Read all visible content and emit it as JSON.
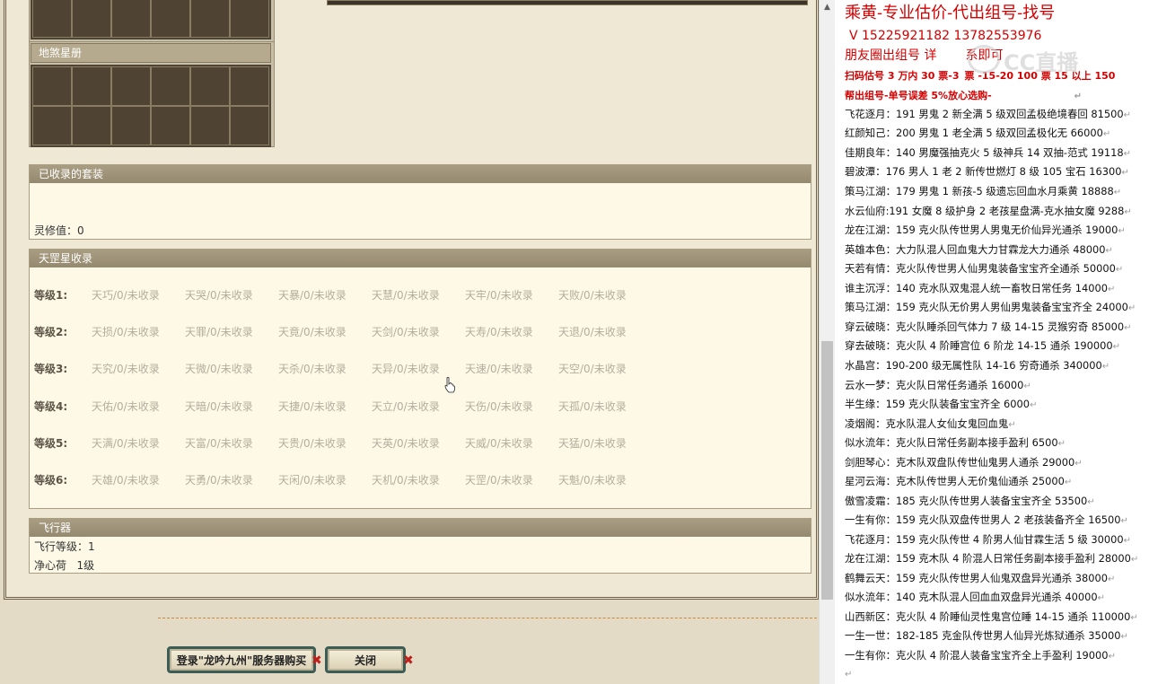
{
  "game": {
    "earth_star_header": "地煞星册",
    "suits_header": "已收录的套装",
    "spirit_value_label": "灵修值：",
    "spirit_value": "0",
    "tiangang_header": "天罡星收录",
    "levels": [
      {
        "label": "等级1:",
        "stars": [
          "天巧/0/未收录",
          "天哭/0/未收录",
          "天暴/0/未收录",
          "天慧/0/未收录",
          "天牢/0/未收录",
          "天败/0/未收录"
        ]
      },
      {
        "label": "等级2:",
        "stars": [
          "天损/0/未收录",
          "天罪/0/未收录",
          "天竟/0/未收录",
          "天剑/0/未收录",
          "天寿/0/未收录",
          "天退/0/未收录"
        ]
      },
      {
        "label": "等级3:",
        "stars": [
          "天究/0/未收录",
          "天微/0/未收录",
          "天杀/0/未收录",
          "天异/0/未收录",
          "天速/0/未收录",
          "天空/0/未收录"
        ]
      },
      {
        "label": "等级4:",
        "stars": [
          "天佑/0/未收录",
          "天暗/0/未收录",
          "天捷/0/未收录",
          "天立/0/未收录",
          "天伤/0/未收录",
          "天孤/0/未收录"
        ]
      },
      {
        "label": "等级5:",
        "stars": [
          "天满/0/未收录",
          "天富/0/未收录",
          "天贵/0/未收录",
          "天英/0/未收录",
          "天威/0/未收录",
          "天猛/0/未收录"
        ]
      },
      {
        "label": "等级6:",
        "stars": [
          "天雄/0/未收录",
          "天勇/0/未收录",
          "天闲/0/未收录",
          "天机/0/未收录",
          "天罡/0/未收录",
          "天魁/0/未收录"
        ]
      }
    ],
    "aircraft_header": "飞行器",
    "aircraft_level_label": "飞行等级：",
    "aircraft_level": "1",
    "jingxin_label": "净心荷",
    "jingxin_value": "1级",
    "buy_button": "登录\"龙吟九州\"服务器购买",
    "close_button": "关闭",
    "close_x": "✖"
  },
  "doc": {
    "title": "乘黄-专业估价-代出组号-找号",
    "contact": "V 15225921182   13782553976",
    "moments": "朋友圈出组号    详",
    "moments_tail": "系即可",
    "watermark": "CC直播",
    "line_red1": "扫码估号 3 万内 30 票-3",
    "line_red1_tail": "票 -15-20 100 票 15 以上 150",
    "line_red2": "帮出组号-单号误差 5%放心选购-",
    "entries": [
      "飞花逐月：191 男鬼 2 新全满 5 级双回孟极绝境春回 81500",
      "红颜知己：200 男鬼 1 老全满 5 级双回孟极化无 66000",
      "佳期良年：140 男魔强抽克火 5 级神兵 14 双抽-范式 19118",
      "碧波潭：176 男人 1 老 2 新传世燃灯 8 级 105 宝石 16300",
      "策马江湖：179 男鬼 1 新孩-5 级遗忘回血水月乘黄 18888",
      "水云仙府:191 女魔 8 级护身 2 老孩星盘满-克水抽女魔 9288",
      "龙在江湖：159 克火队传世男人男鬼无价仙异光通杀 19000",
      "英雄本色：大力队混人回血鬼大力甘霖龙大力通杀 48000",
      "天若有情：克火队传世男人仙男鬼装备宝宝齐全通杀 50000",
      "谁主沉浮：140 克水队双鬼混人统一畜牧日常任务 14000",
      "策马江湖：159 克火队无价男人男仙男鬼装备宝宝齐全 24000",
      "穿云破晓：克火队睡杀回气体力 7 级 14-15 灵猴穷奇 85000",
      "穿去破晓：克火队 4 阶睡宫位 6 阶龙 14-15 通杀 190000",
      "水晶宫：190-200 级无属性队 14-16 穷奇通杀 340000",
      "云水一梦：克火队日常任务通杀 16000",
      "半生缘：159 克火队装备宝宝齐全 6000",
      "凌烟阁：克水队混人女仙女鬼回血鬼",
      "似水流年：克火队日常任务副本接手盈利 6500",
      "剑胆琴心：克木队双盘队传世仙鬼男人通杀 29000",
      "星河云海：克木队传世男人无价鬼仙通杀 25000",
      "傲雪凌霜：185 克火队传世男人装备宝宝齐全 53500",
      "一生有你：159 克火队双盘传世男人 2 老孩装备齐全 16500",
      "飞花逐月：159 克火队传世 4 阶男人仙甘霖生活 5 级 30000",
      "龙在江湖：159 克木队 4 阶混人日常任务副本接手盈利 28000",
      "鹤舞云天：159 克火队传世男人仙鬼双盘异光通杀 38000",
      "似水流年：140 克木队混人回血血双盘异光通杀 40000",
      "山西新区：克火队 4 阶睡仙灵性鬼宫位睡 14-15 通杀 110000",
      "一生一世：182-185 克金队传世男人仙异光炼狱通杀 35000",
      "一生有你：克火队 4 阶混人装备宝宝齐全上手盈利 19000"
    ],
    "para_mark": "↵"
  }
}
